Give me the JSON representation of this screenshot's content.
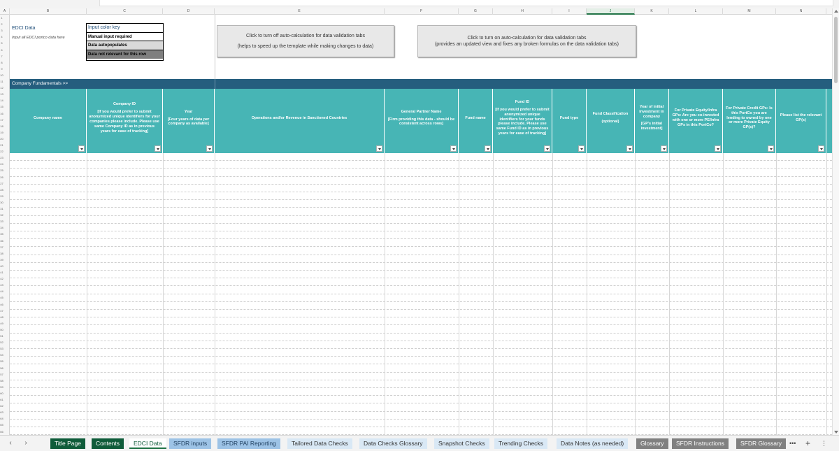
{
  "columns": [
    "A",
    "B",
    "C",
    "D",
    "E",
    "F",
    "G",
    "H",
    "I",
    "J",
    "K",
    "L",
    "M",
    "N"
  ],
  "rows": [
    "1",
    "2",
    "3",
    "4",
    "5",
    "6",
    "7",
    "8",
    "9",
    "10",
    "11",
    "12",
    "13",
    "14",
    "15",
    "16",
    "17",
    "18",
    "19",
    "20",
    "21",
    "22",
    "23",
    "24",
    "25",
    "26",
    "27",
    "28",
    "29",
    "30",
    "31",
    "32",
    "33",
    "34",
    "35",
    "36",
    "37",
    "38",
    "39",
    "40",
    "41",
    "42",
    "43",
    "44",
    "45",
    "46",
    "47",
    "48",
    "49",
    "50",
    "51",
    "52",
    "53",
    "54",
    "55",
    "56",
    "57",
    "58",
    "59",
    "60",
    "61",
    "62",
    "63",
    "64",
    "65",
    "66",
    "67"
  ],
  "top": {
    "edci_title": "EDCI Data",
    "edci_subtitle": "Input all EDCI portco data here"
  },
  "color_key": {
    "title": "Input color key",
    "manual": "Manual input required",
    "auto": "Data autopopulates",
    "not_relevant": "Data not relevant for this row"
  },
  "buttons": {
    "turn_off_line1": "Click to turn off auto-calculation for data validation tabs",
    "turn_off_line2": "(helps to speed up the template while making changes to data)",
    "turn_on_line1": "Click to turn on auto-calculation for data validation tabs",
    "turn_on_line2": "(provides an updated view and fixes any broken formulas on the data validation tabs)"
  },
  "section": {
    "label": "Company Fundamentals >>"
  },
  "headers": [
    {
      "title": "Company name",
      "note": ""
    },
    {
      "title": "Company ID",
      "note": "[If you would prefer to submit anonymized unique identifiers for your companies please include. Please use same Company ID as in previous years for ease of tracking]"
    },
    {
      "title": "Year",
      "note": "[Four years of data per company as available]"
    },
    {
      "title": "Operations and/or Revenue in Sanctioned Countries",
      "note": ""
    },
    {
      "title": "General Partner Name",
      "note": "[Firm providing this data - should be consistent across rows]"
    },
    {
      "title": "Fund name",
      "note": ""
    },
    {
      "title": "Fund ID",
      "note": "[If you would prefer to submit anonymized unique identifiers for your funds please include. Please use same Fund ID as in previous years for ease of tracking]"
    },
    {
      "title": "Fund type",
      "note": ""
    },
    {
      "title": "Fund Classification",
      "note": "(optional)"
    },
    {
      "title": "Year of initial investment in company",
      "note": "[GP's initial investment]"
    },
    {
      "title": "For Private Equity/Infra GPs: Are you co-invested with one or more PE/Infra GPs in this PortCo?",
      "note": ""
    },
    {
      "title": "For Private Credit GPs: Is this PortCo you are lending to owned by one or more Private Equity GP(s)?",
      "note": ""
    },
    {
      "title": "Please list the relevant GP(s)",
      "note": ""
    }
  ],
  "sheet_tabs": [
    {
      "label": "Title Page",
      "style": "green"
    },
    {
      "label": "Contents",
      "style": "green"
    },
    {
      "label": "EDCI Data",
      "style": "active"
    },
    {
      "label": "SFDR inputs",
      "style": "blue"
    },
    {
      "label": "SFDR PAI Reporting",
      "style": "blue"
    },
    {
      "label": "Tailored Data Checks",
      "style": "lightblue"
    },
    {
      "label": "Data Checks Glossary",
      "style": "lightblue"
    },
    {
      "label": "Snapshot Checks",
      "style": "lightblue"
    },
    {
      "label": "Trending Checks",
      "style": "lightblue"
    },
    {
      "label": "Data Notes (as needed)",
      "style": "lightblue"
    },
    {
      "label": "Glossary",
      "style": "grey"
    },
    {
      "label": "SFDR Instructions",
      "style": "grey"
    },
    {
      "label": "SFDR Glossary",
      "style": "grey"
    }
  ],
  "tab_controls": {
    "more": "•••",
    "add": "+",
    "options": "⋮",
    "prev": "‹",
    "next": "›"
  }
}
